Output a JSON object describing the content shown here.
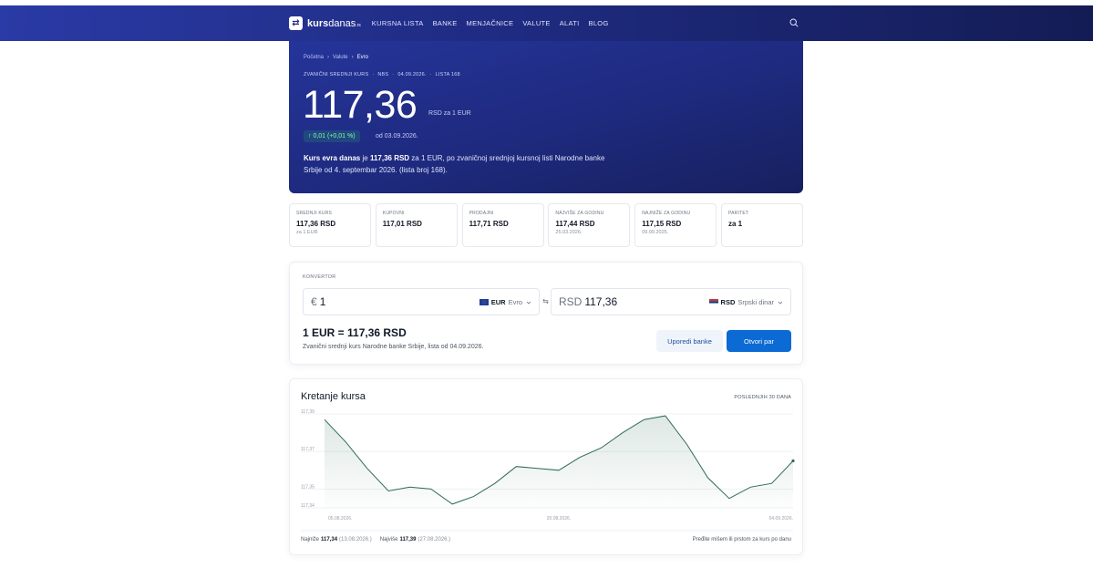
{
  "nav": {
    "logo_mark": "⇄",
    "logo_bold": "kurs",
    "logo_thin": "danas",
    "logo_tld": ".rs",
    "links": [
      "KURSNA LISTA",
      "BANKE",
      "MENJAČNICE",
      "VALUTE",
      "ALATI",
      "BLOG"
    ]
  },
  "hero": {
    "breadcrumb": [
      "Početna",
      "Valute",
      "Evro"
    ],
    "meta": [
      "ZVANIČNI SREDNJI KURS",
      "NBS",
      "04.09.2026.",
      "LISTA 168"
    ],
    "rate": "117,36",
    "unit": "RSD za 1 EUR",
    "change": "↑ 0,01  (+0,01 %)",
    "since": "od 03.09.2026.",
    "desc_pre": "Kurs evra danas",
    "desc_mid1": " je ",
    "desc_bold": "117,36 RSD",
    "desc_post": " za 1 EUR, po zvaničnoj srednjoj kursnoj listi Narodne banke Srbije od 4. septembar 2026. (lista broj 168)."
  },
  "stats": [
    {
      "label": "SREDNJI KURS",
      "value": "117,36 RSD",
      "sub": "za 1 EUR"
    },
    {
      "label": "KUPOVNI",
      "value": "117,01 RSD",
      "sub": ""
    },
    {
      "label": "PRODAJNI",
      "value": "117,71 RSD",
      "sub": ""
    },
    {
      "label": "NAJVIŠE ZA GODINU",
      "value": "117,44 RSD",
      "sub": "25.03.2026."
    },
    {
      "label": "NAJNIŽE ZA GODINU",
      "value": "117,15 RSD",
      "sub": "09.09.2025."
    },
    {
      "label": "PARITET",
      "value": "za 1",
      "sub": ""
    }
  ],
  "converter": {
    "label": "KONVERTOR",
    "from_prefix": "€",
    "from_amount": "1",
    "from_code": "EUR",
    "from_name": "Evro",
    "to_prefix": "RSD",
    "to_amount": "117,36",
    "to_code": "RSD",
    "to_name": "Srpski dinar",
    "swap": "⇆",
    "result": "1 EUR = 117,36 RSD",
    "note": "Zvanični srednji kurs Narodne banke Srbije, lista od 04.09.2026.",
    "compare_label": "Uporedi banke",
    "open_label": "Otvori par"
  },
  "chart_footer": {
    "min_label": "Najniže",
    "min_value": "117,34",
    "min_date": "(13.08.2026.)",
    "max_label": "Najviše",
    "max_value": "117,39",
    "max_date": "(27.08.2026.)",
    "hint": "Pređite mišem ili prstom za kurs po danu"
  },
  "colors": {
    "nav_bg": "#1e2a7e",
    "accent": "#0b6ad4",
    "line": "#2f6b52",
    "change": "#8ff0b1"
  },
  "chart_data": {
    "type": "area",
    "title": "Kretanje kursa",
    "period_label": "POSLEDNJIH 30 DANA",
    "xlabel": "",
    "ylabel": "",
    "ylim": [
      117.34,
      117.39
    ],
    "yticks": [
      "117,39",
      "117,37",
      "117,35",
      "117,34"
    ],
    "ytick_values": [
      117.39,
      117.37,
      117.35,
      117.34
    ],
    "xticks": [
      "05.08.2026.",
      "20.08.2026.",
      "04.09.2026."
    ],
    "xtick_index": [
      0,
      15,
      30
    ],
    "grid": true,
    "values": [
      117.387,
      117.375,
      117.361,
      117.349,
      117.351,
      117.35,
      117.342,
      117.346,
      117.353,
      117.362,
      117.361,
      117.36,
      117.367,
      117.372,
      117.38,
      117.387,
      117.389,
      117.374,
      117.356,
      117.345,
      117.351,
      117.353,
      117.365
    ]
  }
}
